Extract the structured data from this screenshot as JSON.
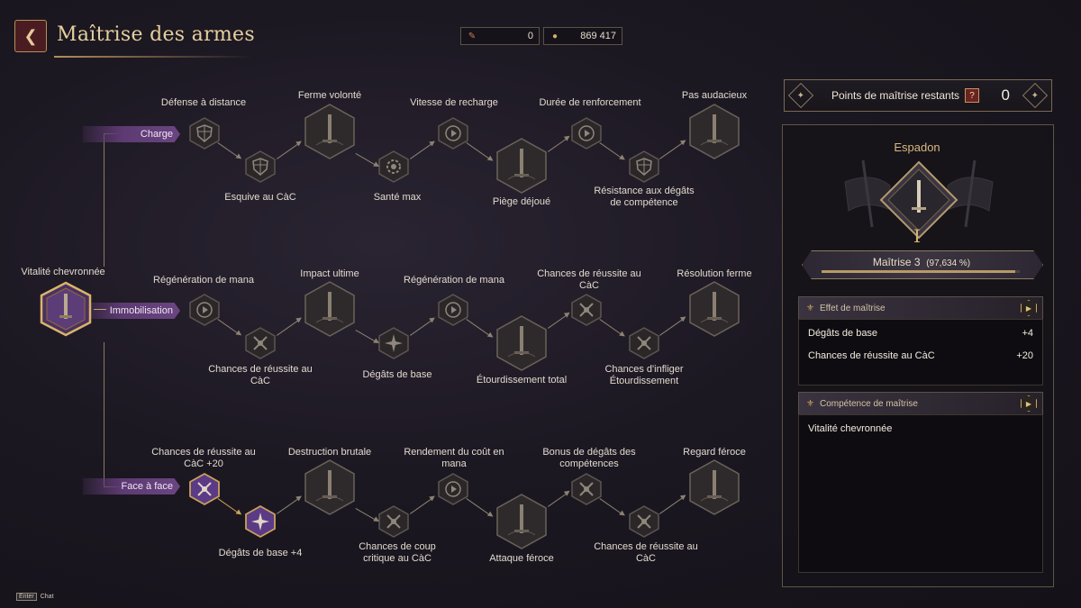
{
  "header": {
    "title": "Maîtrise des armes",
    "currency_1": "0",
    "currency_2": "869 417"
  },
  "rows": {
    "charge": "Charge",
    "immobilisation": "Immobilisation",
    "face": "Face à face"
  },
  "root": {
    "label": "Vitalité chevronnée"
  },
  "tree": {
    "r1": [
      "Défense à distance",
      "Esquive au CàC",
      "Ferme volonté",
      "Santé max",
      "Vitesse de recharge",
      "Piège déjoué",
      "Durée de renforcement",
      "Résistance aux dégâts",
      "de compétence",
      "Pas audacieux"
    ],
    "r2": [
      "Régénération de mana",
      "Chances de réussite au",
      "CàC",
      "Impact ultime",
      "Dégâts de base",
      "Régénération de mana",
      "Étourdissement total",
      "Chances de réussite au",
      "CàC",
      "Chances d'infliger",
      "Étourdissement",
      "Résolution ferme"
    ],
    "r3": [
      "Chances de réussite au",
      "CàC +20",
      "Dégâts de base  +4",
      "Destruction brutale",
      "Chances de coup",
      "critique au CàC",
      "Rendement du coût en",
      "mana",
      "Attaque féroce",
      "Bonus de dégâts des",
      "compétences",
      "Chances de réussite au",
      "CàC",
      "Regard féroce"
    ]
  },
  "panel": {
    "points_label": "Points de maîtrise restants",
    "points_help": "?",
    "points_value": "0",
    "weapon": "Espadon",
    "rank_numeral": "I",
    "mastery_label": "Maîtrise 3",
    "mastery_percent": "(97,634 %)",
    "mastery_progress": 0.976,
    "effect_title": "Effet de maîtrise",
    "stats": [
      {
        "name": "Dégâts de base",
        "value": "+4"
      },
      {
        "name": "Chances de réussite au CàC",
        "value": "+20"
      }
    ],
    "skill_title": "Compétence de maîtrise",
    "skill_name": "Vitalité chevronnée"
  },
  "footer": {
    "key": "Enter",
    "label": "Chat"
  },
  "colors": {
    "gold": "#c9a25a",
    "purple_active": "#5b3a86",
    "dark_node": "#2b2729",
    "accent_red": "#4a1c22"
  },
  "icons": [
    "back-arrow-icon",
    "feather-icon",
    "coin-icon",
    "shield-icon",
    "gear-icon",
    "sword-icon",
    "crossed-swords-icon",
    "fleur-de-lis-icon",
    "play-icon"
  ]
}
